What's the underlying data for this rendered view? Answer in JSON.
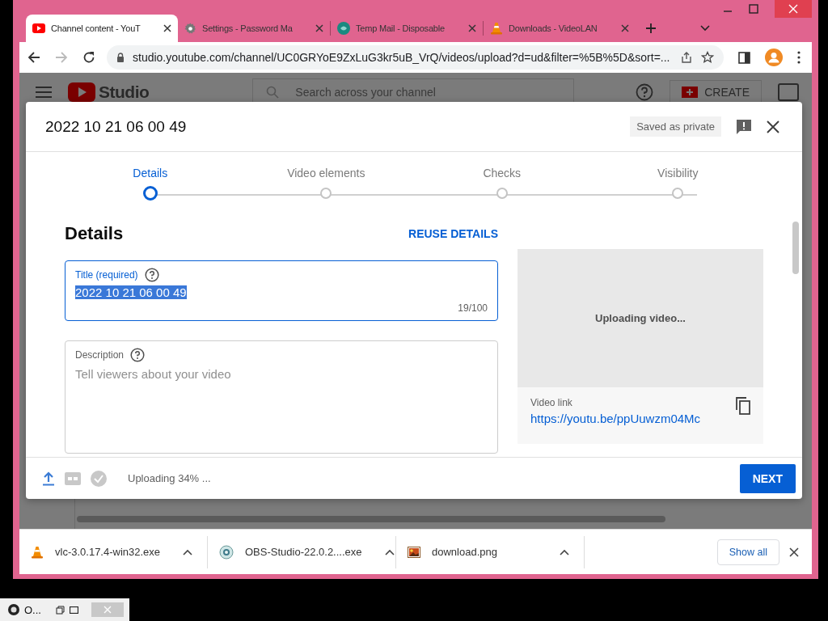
{
  "tabs": [
    {
      "kind": "youtube",
      "title": "Channel content - YouT",
      "selected": true
    },
    {
      "kind": "gear",
      "title": "Settings - Password Ma",
      "selected": false
    },
    {
      "kind": "tempmail",
      "title": "Temp Mail - Disposable",
      "selected": false
    },
    {
      "kind": "vlc",
      "title": "Downloads - VideoLAN",
      "selected": false
    }
  ],
  "address_bar": {
    "url": "studio.youtube.com/channel/UC0GRYoE9ZxLuG3kr5uB_VrQ/videos/upload?d=ud&filter=%5B%5D&sort=..."
  },
  "background_page": {
    "logo_text": "Studio",
    "search_placeholder": "Search across your channel",
    "create_button": "CREATE"
  },
  "dialog": {
    "title": "2022 10 21 06 00 49",
    "save_status": "Saved as private",
    "steps": [
      {
        "label": "Details",
        "selected": true
      },
      {
        "label": "Video elements",
        "selected": false
      },
      {
        "label": "Checks",
        "selected": false
      },
      {
        "label": "Visibility",
        "selected": false
      }
    ],
    "section_title": "Details",
    "reuse_link": "REUSE DETAILS",
    "title_field": {
      "label": "Title (required)",
      "value": "2022 10 21 06 00 49",
      "counter": "19/100",
      "focused": true,
      "text_selected": true
    },
    "description_field": {
      "label": "Description",
      "placeholder": "Tell viewers about your video"
    },
    "preview": {
      "status": "Uploading video...",
      "link_label": "Video link",
      "link": "https://youtu.be/ppUuwzm04Mc"
    },
    "upload_status": "Uploading 34% ...",
    "next_button": "NEXT"
  },
  "downloads": [
    {
      "kind": "vlc",
      "name": "vlc-3.0.17.4-win32.exe"
    },
    {
      "kind": "obs",
      "name": "OBS-Studio-22.0.2....exe"
    },
    {
      "kind": "image",
      "name": "download.png"
    }
  ],
  "show_all": "Show all",
  "taskbar": {
    "label": "O..."
  }
}
